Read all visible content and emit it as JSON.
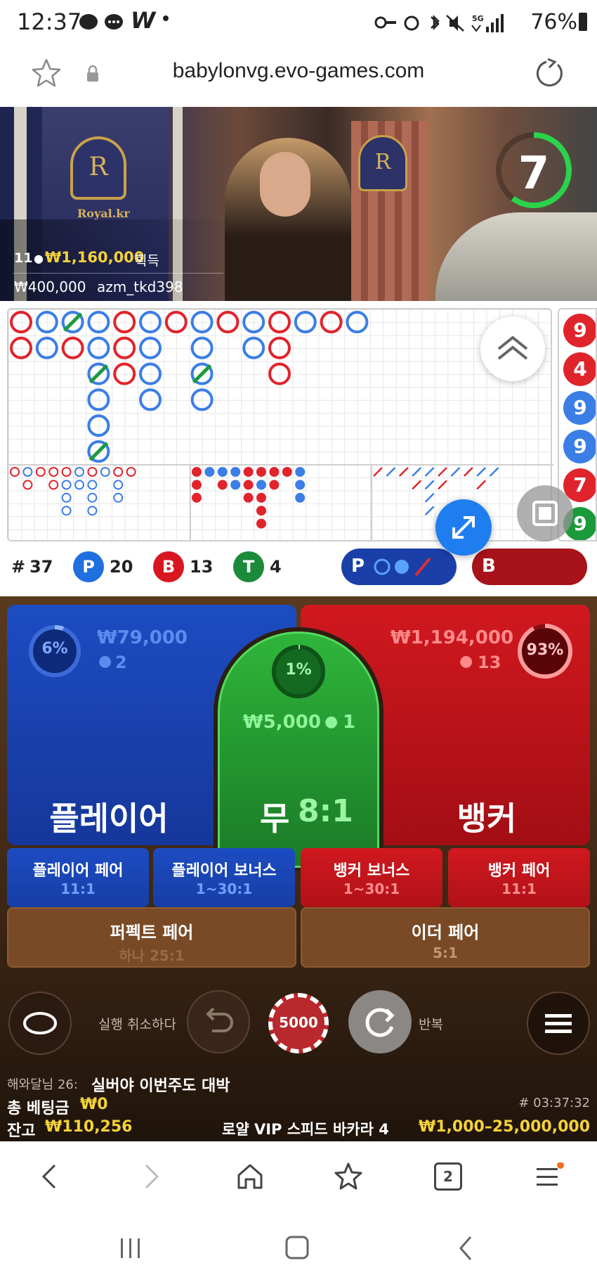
{
  "status_bar": {
    "time": "12:37",
    "app_letter": "W",
    "battery": "76%"
  },
  "browser": {
    "url": "babylonvg.evo-games.com",
    "tab_count": "2"
  },
  "video": {
    "timer": "7",
    "logo_name": "Royal.kr",
    "winners_count": "11",
    "winnings": "₩1,160,000",
    "winnings_suffix": "획득",
    "top_amount": "₩400,000",
    "top_user": "azm_tkd398"
  },
  "roadmap": {
    "round_prefix": "#",
    "round_number": "37",
    "p_label": "P",
    "p_count": "20",
    "b_label": "B",
    "b_count": "13",
    "t_label": "T",
    "t_count": "4",
    "next_p_label": "P",
    "next_b_label": "B",
    "side_numbers": [
      "9",
      "4",
      "9",
      "9",
      "7",
      "9"
    ],
    "bead_columns": [
      [
        "R",
        "R"
      ],
      [
        "B",
        "B"
      ],
      [
        "BT",
        "R"
      ],
      [
        "B",
        "B",
        "BT",
        "B",
        "B",
        "BT"
      ],
      [
        "R",
        "R",
        "R"
      ],
      [
        "B",
        "B",
        "B",
        "B"
      ],
      [
        "R"
      ],
      [
        "B",
        "B",
        "BT",
        "B"
      ],
      [
        "R"
      ],
      [
        "B",
        "B"
      ],
      [
        "R",
        "R",
        "R"
      ],
      [
        "B"
      ],
      [
        "R"
      ],
      [
        "B"
      ]
    ]
  },
  "bets": {
    "player": {
      "label": "플레이어",
      "percent": "6%",
      "amount": "₩79,000",
      "players": "2",
      "color": "#1645b5"
    },
    "tie": {
      "label": "무",
      "odds": "8:1",
      "percent": "1%",
      "amount": "₩5,000",
      "players": "1",
      "color": "#1c8a2c"
    },
    "banker": {
      "label": "뱅커",
      "percent": "93%",
      "amount": "₩1,194,000",
      "players": "13",
      "color": "#c8141c"
    },
    "side": [
      {
        "label": "플레이어 페어",
        "odds": "11:1",
        "color": "blue"
      },
      {
        "label": "플레이어 보너스",
        "odds": "1~30:1",
        "color": "blue"
      },
      {
        "label": "뱅커 보너스",
        "odds": "1~30:1",
        "color": "red"
      },
      {
        "label": "뱅커 페어",
        "odds": "11:1",
        "color": "red"
      }
    ],
    "pairs": [
      {
        "label": "퍼펙트 페어",
        "odds": "하나 25:1"
      },
      {
        "label": "이더 페어",
        "odds": "5:1"
      }
    ]
  },
  "controls": {
    "undo_label": "실행 취소하다",
    "chip_value": "5000",
    "repeat_label": "반복"
  },
  "footer": {
    "chat_user": "해와달님 26:",
    "chat_message": "실버야 이번주도 대박",
    "total_bet_label": "총 베팅금",
    "total_bet": "₩0",
    "game_id": "# 03:37:32",
    "balance_label": "잔고",
    "balance": "₩110,256",
    "table_name": "로얄 VIP 스피드 바카라 4",
    "limits": "₩1,000–25,000,000"
  }
}
